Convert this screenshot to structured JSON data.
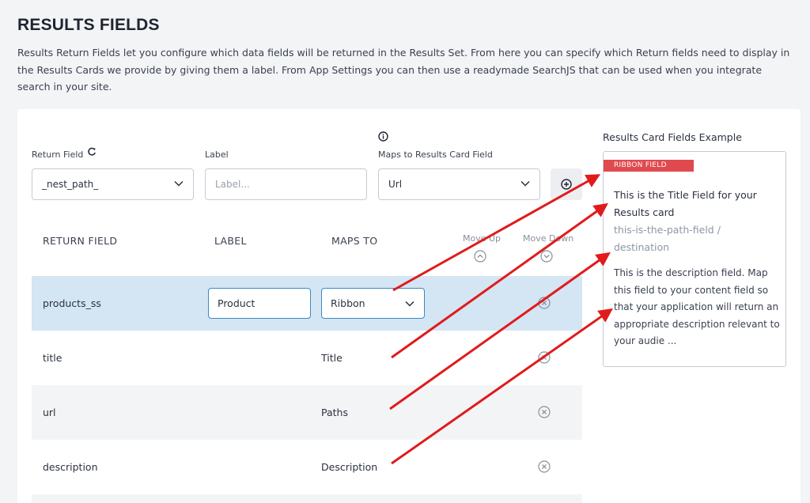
{
  "page": {
    "title": "RESULTS FIELDS",
    "description": "Results Return Fields let you configure which data fields will be returned in the Results Set. From here you can specify which Return fields need to display in the Results Cards we provide by giving them a label. From App Settings you can then use a readymade SearchJS that can be used when you integrate search in your site."
  },
  "form": {
    "return_field_label": "Return Field",
    "return_field_value": "_nest_path_",
    "label_label": "Label",
    "label_placeholder": "Label...",
    "maps_to_label": "Maps to Results Card Field",
    "maps_to_value": "Url"
  },
  "table": {
    "headers": {
      "return_field": "RETURN FIELD",
      "label": "LABEL",
      "maps_to": "MAPS TO",
      "move_up": "Move Up",
      "move_down": "Move Down"
    },
    "rows": [
      {
        "field": "products_ss",
        "label": "Product",
        "maps_to": "Ribbon"
      },
      {
        "field": "title",
        "label": "",
        "maps_to": "Title"
      },
      {
        "field": "url",
        "label": "",
        "maps_to": "Paths"
      },
      {
        "field": "description",
        "label": "",
        "maps_to": "Description"
      }
    ]
  },
  "card": {
    "heading": "Results Card Fields Example",
    "ribbon": "RIBBON FIELD",
    "title": "This is the Title Field for your Results card",
    "path": "this-is-the-path-field / destination",
    "description": "This is the description field. Map this field to your content field so that your application will return an appropriate description relevant to your audie ..."
  },
  "colors": {
    "ribbon": "#e04a4f",
    "highlight_row": "#d4e5f3",
    "annotation_arrow": "#e01b1b"
  }
}
